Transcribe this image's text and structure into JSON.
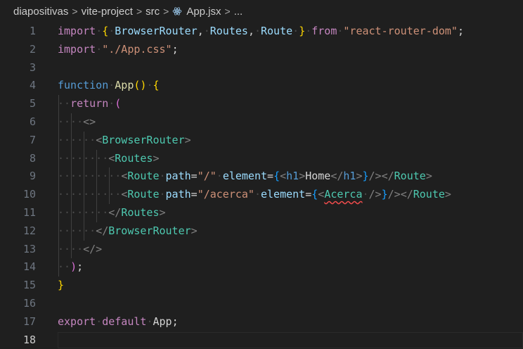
{
  "breadcrumb": {
    "items": [
      "diapositivas",
      "vite-project",
      "src"
    ],
    "file": "App.jsx",
    "more": "...",
    "separator": ">"
  },
  "editor": {
    "current_line": 18,
    "lines": [
      {
        "n": "1",
        "tokens": [
          [
            "kw",
            "import"
          ],
          [
            "ws",
            "·"
          ],
          [
            "br1",
            "{"
          ],
          [
            "ws",
            "·"
          ],
          [
            "var",
            "BrowserRouter"
          ],
          [
            "pl",
            ","
          ],
          [
            "ws",
            "·"
          ],
          [
            "var",
            "Routes"
          ],
          [
            "pl",
            ","
          ],
          [
            "ws",
            "·"
          ],
          [
            "var",
            "Route"
          ],
          [
            "ws",
            "·"
          ],
          [
            "br1",
            "}"
          ],
          [
            "ws",
            "·"
          ],
          [
            "kw",
            "from"
          ],
          [
            "ws",
            "·"
          ],
          [
            "str",
            "\"react-router-dom\""
          ],
          [
            "pl",
            ";"
          ]
        ]
      },
      {
        "n": "2",
        "tokens": [
          [
            "kw",
            "import"
          ],
          [
            "ws",
            "·"
          ],
          [
            "str",
            "\"./App.css\""
          ],
          [
            "pl",
            ";"
          ]
        ]
      },
      {
        "n": "3",
        "tokens": []
      },
      {
        "n": "4",
        "tokens": [
          [
            "kwb",
            "function"
          ],
          [
            "ws",
            "·"
          ],
          [
            "fn",
            "App"
          ],
          [
            "br1",
            "()"
          ],
          [
            "ws",
            "·"
          ],
          [
            "br1",
            "{"
          ]
        ]
      },
      {
        "n": "5",
        "tokens": [
          [
            "ws",
            "··"
          ],
          [
            "kw",
            "return"
          ],
          [
            "ws",
            "·"
          ],
          [
            "br2",
            "("
          ]
        ]
      },
      {
        "n": "6",
        "tokens": [
          [
            "ws",
            "····"
          ],
          [
            "ang",
            "<>"
          ]
        ]
      },
      {
        "n": "7",
        "tokens": [
          [
            "ws",
            "······"
          ],
          [
            "ang",
            "<"
          ],
          [
            "tag",
            "BrowserRouter"
          ],
          [
            "ang",
            ">"
          ]
        ]
      },
      {
        "n": "8",
        "tokens": [
          [
            "ws",
            "········"
          ],
          [
            "ang",
            "<"
          ],
          [
            "tag",
            "Routes"
          ],
          [
            "ang",
            ">"
          ]
        ]
      },
      {
        "n": "9",
        "tokens": [
          [
            "ws",
            "··········"
          ],
          [
            "ang",
            "<"
          ],
          [
            "tag",
            "Route"
          ],
          [
            "ws",
            "·"
          ],
          [
            "attr",
            "path"
          ],
          [
            "pl",
            "="
          ],
          [
            "str",
            "\"/\""
          ],
          [
            "ws",
            "·"
          ],
          [
            "attr",
            "element"
          ],
          [
            "pl",
            "="
          ],
          [
            "br3",
            "{"
          ],
          [
            "ang",
            "<"
          ],
          [
            "html",
            "h1"
          ],
          [
            "ang",
            ">"
          ],
          [
            "pl",
            "Home"
          ],
          [
            "ang",
            "</"
          ],
          [
            "html",
            "h1"
          ],
          [
            "ang",
            ">"
          ],
          [
            "br3",
            "}"
          ],
          [
            "ang",
            "/>"
          ],
          [
            "ang",
            "</"
          ],
          [
            "tag",
            "Route"
          ],
          [
            "ang",
            ">"
          ]
        ]
      },
      {
        "n": "10",
        "tokens": [
          [
            "ws",
            "··········"
          ],
          [
            "ang",
            "<"
          ],
          [
            "tag",
            "Route"
          ],
          [
            "ws",
            "·"
          ],
          [
            "attr",
            "path"
          ],
          [
            "pl",
            "="
          ],
          [
            "str",
            "\"/acerca\""
          ],
          [
            "ws",
            "·"
          ],
          [
            "attr",
            "element"
          ],
          [
            "pl",
            "="
          ],
          [
            "br3",
            "{"
          ],
          [
            "ang",
            "<"
          ],
          [
            "tag squig",
            "Acerca"
          ],
          [
            "ws",
            "·"
          ],
          [
            "ang",
            "/>"
          ],
          [
            "br3",
            "}"
          ],
          [
            "ang",
            "/>"
          ],
          [
            "ang",
            "</"
          ],
          [
            "tag",
            "Route"
          ],
          [
            "ang",
            ">"
          ]
        ]
      },
      {
        "n": "11",
        "tokens": [
          [
            "ws",
            "········"
          ],
          [
            "ang",
            "</"
          ],
          [
            "tag",
            "Routes"
          ],
          [
            "ang",
            ">"
          ]
        ]
      },
      {
        "n": "12",
        "tokens": [
          [
            "ws",
            "······"
          ],
          [
            "ang",
            "</"
          ],
          [
            "tag",
            "BrowserRouter"
          ],
          [
            "ang",
            ">"
          ]
        ]
      },
      {
        "n": "13",
        "tokens": [
          [
            "ws",
            "····"
          ],
          [
            "ang",
            "</>"
          ]
        ]
      },
      {
        "n": "14",
        "tokens": [
          [
            "ws",
            "··"
          ],
          [
            "br2",
            ")"
          ],
          [
            "pl",
            ";"
          ]
        ]
      },
      {
        "n": "15",
        "tokens": [
          [
            "br1",
            "}"
          ]
        ]
      },
      {
        "n": "16",
        "tokens": []
      },
      {
        "n": "17",
        "tokens": [
          [
            "kw",
            "export"
          ],
          [
            "ws",
            "·"
          ],
          [
            "kw",
            "default"
          ],
          [
            "ws",
            "·"
          ],
          [
            "pl",
            "App"
          ],
          [
            "pl",
            ";"
          ]
        ]
      },
      {
        "n": "18",
        "tokens": []
      }
    ]
  }
}
